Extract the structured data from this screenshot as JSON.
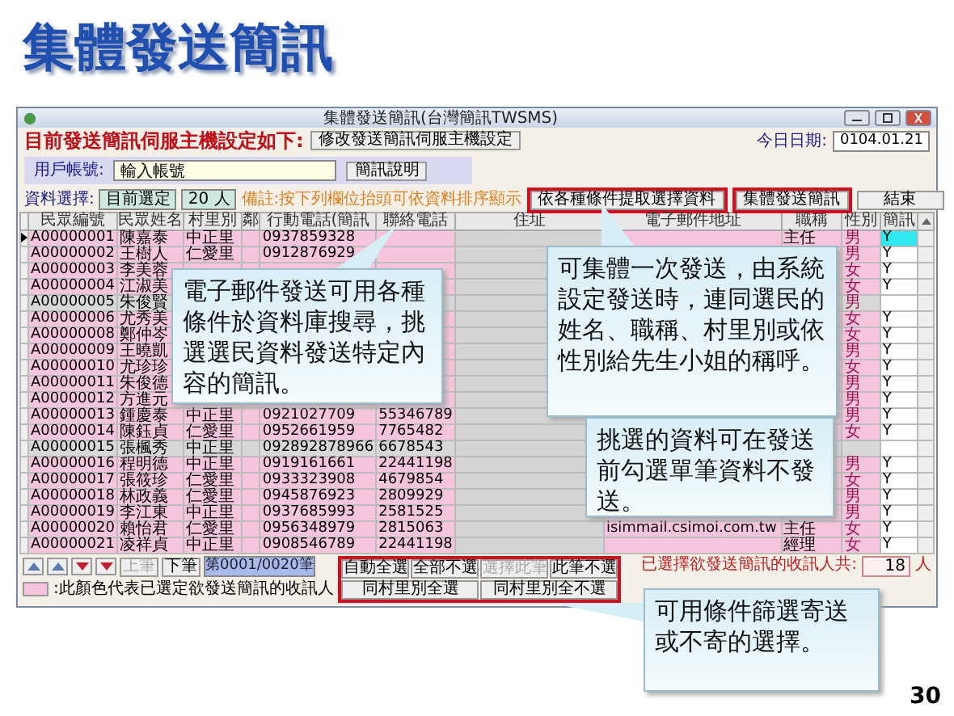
{
  "slide": {
    "title": "集體發送簡訊",
    "page_number": "30"
  },
  "window": {
    "title": "集體發送簡訊(台灣簡訊TWSMS)"
  },
  "server_row": {
    "label": "目前發送簡訊伺服主機設定如下:",
    "button": "修改發送簡訊伺服主機設定",
    "date_label": "今日日期:",
    "date_value": "0104.01.21"
  },
  "account": {
    "label": "用戶帳號:",
    "value": "輸入帳號",
    "button": "簡訊說明"
  },
  "selection": {
    "label": "資料選擇:",
    "value": "目前選定",
    "count": "20 人",
    "note": "備註:按下列欄位抬頭可依資料排序顯示",
    "buttons": [
      {
        "label": "依各種條件提取選擇資料",
        "highlighted": true
      },
      {
        "label": "集體發送簡訊",
        "highlighted": true
      },
      {
        "label": "結束",
        "highlighted": false
      }
    ]
  },
  "table": {
    "columns": [
      "民眾編號",
      "民眾姓名",
      "村里別",
      "鄰",
      "行動電話(簡訊",
      "聯絡電話",
      "住址",
      "電子郵件地址",
      "職稱",
      "性別",
      "簡訊"
    ],
    "rows": [
      {
        "current": true,
        "selected": true,
        "id": "A00000001",
        "name": "陳嘉泰",
        "village": "中正里",
        "mobile": "0937859328",
        "title": "主任",
        "gender": "男",
        "sms": "Y"
      },
      {
        "current": false,
        "selected": true,
        "id": "A00000002",
        "name": "王樹人",
        "village": "仁愛里",
        "mobile": "0912876929",
        "gender": "男",
        "sms": "Y"
      },
      {
        "current": false,
        "selected": true,
        "id": "A00000003",
        "name": "李美蓉",
        "gender": "女",
        "sms": "Y"
      },
      {
        "current": false,
        "selected": true,
        "id": "A00000004",
        "name": "江淑美",
        "gender": "女",
        "sms": "Y"
      },
      {
        "current": false,
        "selected": false,
        "id": "A00000005",
        "name": "朱俊賢",
        "gender": "男"
      },
      {
        "current": false,
        "selected": true,
        "id": "A00000006",
        "name": "尤秀美",
        "gender": "女",
        "sms": "Y"
      },
      {
        "current": false,
        "selected": true,
        "id": "A00000008",
        "name": "鄭仲岑",
        "gender": "女",
        "sms": "Y"
      },
      {
        "current": false,
        "selected": true,
        "id": "A00000009",
        "name": "王曉凱",
        "gender": "男",
        "sms": "Y"
      },
      {
        "current": false,
        "selected": true,
        "id": "A00000010",
        "name": "尤珍珍",
        "gender": "女",
        "sms": "Y"
      },
      {
        "current": false,
        "selected": true,
        "id": "A00000011",
        "name": "朱俊德",
        "gender": "男",
        "sms": "Y"
      },
      {
        "current": false,
        "selected": true,
        "id": "A00000012",
        "name": "方進元",
        "gender": "男",
        "sms": "Y"
      },
      {
        "current": false,
        "selected": true,
        "id": "A00000013",
        "name": "鍾慶泰",
        "village": "中正里",
        "mobile": "0921027709",
        "phone": "55346789",
        "gender": "男",
        "sms": "Y"
      },
      {
        "current": false,
        "selected": true,
        "id": "A00000014",
        "name": "陳鈺貞",
        "village": "仁愛里",
        "mobile": "0952661959",
        "phone": "7765482",
        "gender": "女",
        "sms": "Y"
      },
      {
        "current": false,
        "selected": false,
        "id": "A00000015",
        "name": "張楓秀",
        "village": "中正里",
        "mobile": "092892878966",
        "phone": "6678543"
      },
      {
        "current": false,
        "selected": true,
        "id": "A00000016",
        "name": "程明德",
        "village": "中正里",
        "mobile": "0919161661",
        "phone": "22441198",
        "gender": "男",
        "sms": "Y"
      },
      {
        "current": false,
        "selected": true,
        "id": "A00000017",
        "name": "張筱珍",
        "village": "仁愛里",
        "mobile": "0933323908",
        "phone": "4679854",
        "gender": "女",
        "sms": "Y"
      },
      {
        "current": false,
        "selected": true,
        "id": "A00000018",
        "name": "林政義",
        "village": "仁愛里",
        "mobile": "0945876923",
        "phone": "2809929",
        "gender": "男",
        "sms": "Y"
      },
      {
        "current": false,
        "selected": true,
        "id": "A00000019",
        "name": "李江東",
        "village": "中正里",
        "mobile": "0937685993",
        "phone": "2581525",
        "gender": "男",
        "sms": "Y"
      },
      {
        "current": false,
        "selected": true,
        "id": "A00000020",
        "name": "賴怡君",
        "village": "仁愛里",
        "mobile": "0956348979",
        "phone": "2815063",
        "email": "isimmail.csimoi.com.tw",
        "title": "主任",
        "gender": "女",
        "sms": "Y"
      },
      {
        "current": false,
        "selected": true,
        "id": "A00000021",
        "name": "凌祥貞",
        "village": "中正里",
        "mobile": "0908546789",
        "phone": "22441198",
        "title": "經理",
        "gender": "女",
        "sms": "Y"
      }
    ]
  },
  "navigation": {
    "buttons": [
      {
        "label": "上筆",
        "disabled": true
      },
      {
        "label": "下筆",
        "disabled": false
      }
    ],
    "position": "第0001/0020筆"
  },
  "select_buttons": [
    {
      "label": "自動全選",
      "disabled": false
    },
    {
      "label": "全部不選",
      "disabled": false
    },
    {
      "label": "選擇此筆",
      "disabled": true
    },
    {
      "label": "此筆不選",
      "disabled": false
    }
  ],
  "village_buttons": [
    {
      "label": "同村里別全選"
    },
    {
      "label": "同村里別全不選"
    }
  ],
  "legend": {
    "text": ":此顏色代表已選定欲發送簡訊的收訊人"
  },
  "selected_total": {
    "label": "已選擇欲發送簡訊的收訊人共:",
    "value": "18",
    "unit": "人"
  },
  "callouts": [
    {
      "text": "電子郵件發送可用各種條件於資料庫搜尋，挑選選民資料發送特定內容的簡訊。"
    },
    {
      "text": "可集體一次發送，由系統設定發送時，連同選民的姓名、職稱、村里別或依性別給先生小姐的稱呼。"
    },
    {
      "text": "挑選的資料可在發送前勾選單筆資料不發送。"
    },
    {
      "text": "可用條件篩選寄送或不寄的選擇。"
    }
  ]
}
